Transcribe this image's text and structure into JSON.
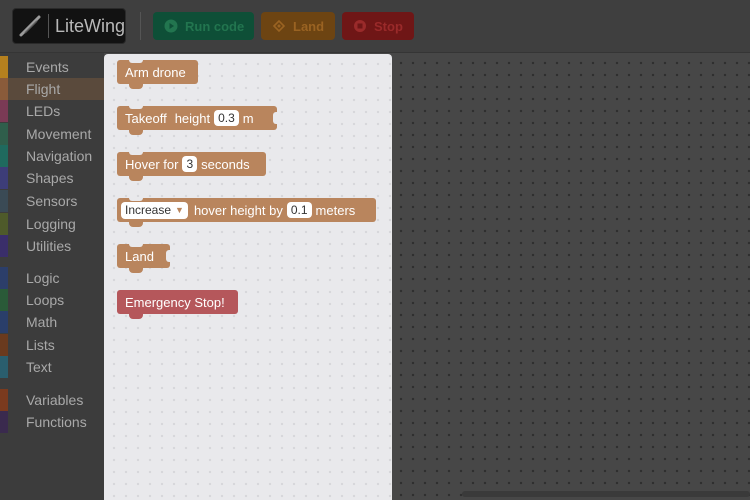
{
  "header": {
    "app_name": "LiteWing",
    "buttons": {
      "run": "Run code",
      "land": "Land",
      "stop": "Stop"
    }
  },
  "categories": [
    {
      "label": "Events",
      "color": "#b5801e"
    },
    {
      "label": "Flight",
      "color": "#8a5b3a",
      "selected": true
    },
    {
      "label": "LEDs",
      "color": "#7a3a55"
    },
    {
      "label": "Movement",
      "color": "#2f5e4b"
    },
    {
      "label": "Navigation",
      "color": "#1f6a5e"
    },
    {
      "label": "Shapes",
      "color": "#3d3d78"
    },
    {
      "label": "Sensors",
      "color": "#3a4a55"
    },
    {
      "label": "Logging",
      "color": "#4e5a2a"
    },
    {
      "label": "Utilities",
      "color": "#3a2e6a"
    },
    {
      "label": "Logic",
      "color": "#2c3e6a"
    },
    {
      "label": "Loops",
      "color": "#2a5a38"
    },
    {
      "label": "Math",
      "color": "#2a3e6a"
    },
    {
      "label": "Lists",
      "color": "#6a3a1e"
    },
    {
      "label": "Text",
      "color": "#2a5e6e"
    },
    {
      "label": "Variables",
      "color": "#7a3a1e"
    },
    {
      "label": "Functions",
      "color": "#3a2a4e"
    }
  ],
  "flyout": {
    "arm": "Arm drone",
    "takeoff": {
      "label": "Takeoff",
      "word": "height",
      "value": "0.3",
      "unit": "m"
    },
    "hover": {
      "label": "Hover for",
      "value": "3",
      "unit": "seconds"
    },
    "adjust": {
      "option": "Increase",
      "text": "hover height by",
      "value": "0.1",
      "unit": "meters"
    },
    "land": "Land",
    "emergency": "Emergency Stop!"
  }
}
